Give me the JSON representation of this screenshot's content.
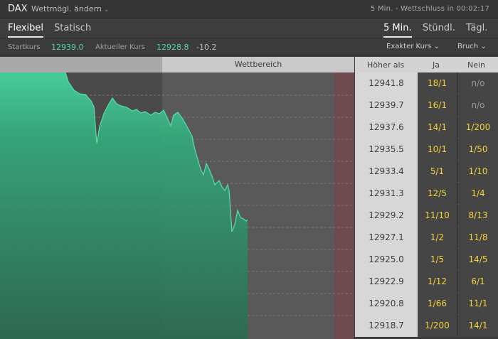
{
  "header": {
    "instrument": "DAX",
    "change_label": "Wettmögl. ändern",
    "expiry": "5 Min. - Wettschluss in 00:02:17"
  },
  "tabs": {
    "left": [
      {
        "label": "Flexibel",
        "active": true
      },
      {
        "label": "Statisch",
        "active": false
      }
    ],
    "right": [
      {
        "label": "5 Min.",
        "active": true
      },
      {
        "label": "Stündl.",
        "active": false
      },
      {
        "label": "Tägl.",
        "active": false
      }
    ]
  },
  "info": {
    "start_label": "Startkurs",
    "start_value": "12939.0",
    "current_label": "Aktueller Kurs",
    "current_value": "12928.8",
    "diff": "-10.2",
    "dropdown_exact": "Exakter Kurs",
    "dropdown_format": "Bruch"
  },
  "chart": {
    "range_label": "Wettbereich",
    "accent": "#3fcf98"
  },
  "table": {
    "col_price": "Höher als",
    "col_yes": "Ja",
    "col_no": "Nein",
    "rows": [
      {
        "price": "12941.8",
        "yes": "18/1",
        "no": "n/o"
      },
      {
        "price": "12939.7",
        "yes": "16/1",
        "no": "n/o"
      },
      {
        "price": "12937.6",
        "yes": "14/1",
        "no": "1/200"
      },
      {
        "price": "12935.5",
        "yes": "10/1",
        "no": "1/50"
      },
      {
        "price": "12933.4",
        "yes": "5/1",
        "no": "1/10"
      },
      {
        "price": "12931.3",
        "yes": "12/5",
        "no": "1/4"
      },
      {
        "price": "12929.2",
        "yes": "11/10",
        "no": "8/13"
      },
      {
        "price": "12927.1",
        "yes": "1/2",
        "no": "11/8"
      },
      {
        "price": "12925.0",
        "yes": "1/5",
        "no": "14/5"
      },
      {
        "price": "12922.9",
        "yes": "1/12",
        "no": "6/1"
      },
      {
        "price": "12920.8",
        "yes": "1/66",
        "no": "11/1"
      },
      {
        "price": "12918.7",
        "yes": "1/200",
        "no": "14/1"
      }
    ]
  }
}
